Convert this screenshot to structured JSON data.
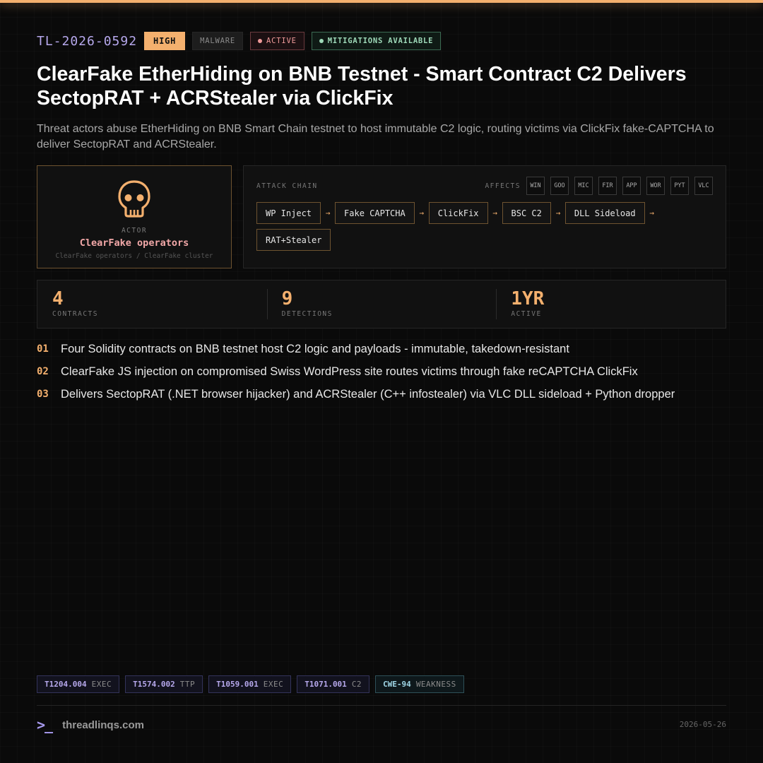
{
  "header": {
    "ticket_id": "TL-2026-0592",
    "severity": "HIGH",
    "category": "MALWARE",
    "status": "ACTIVE",
    "mitigation": "MITIGATIONS AVAILABLE"
  },
  "title": "ClearFake EtherHiding on BNB Testnet - Smart Contract C2 Delivers SectopRAT + ACRStealer via ClickFix",
  "subtitle": "Threat actors abuse EtherHiding on BNB Smart Chain testnet to host immutable C2 logic, routing victims via ClickFix fake-CAPTCHA to deliver SectopRAT and ACRStealer.",
  "actor": {
    "icon": "skull-icon",
    "label": "ACTOR",
    "name": "ClearFake operators",
    "aliases": "ClearFake operators / ClearFake cluster"
  },
  "chain": {
    "label": "ATTACK CHAIN",
    "affects_label": "AFFECTS",
    "affects": [
      "WIN",
      "GOO",
      "MIC",
      "FIR",
      "APP",
      "WOR",
      "PYT",
      "VLC"
    ],
    "arrow": "→",
    "steps": [
      "WP Inject",
      "Fake CAPTCHA",
      "ClickFix",
      "BSC C2",
      "DLL Sideload",
      "RAT+Stealer"
    ]
  },
  "stats": [
    {
      "value": "4",
      "label": "CONTRACTS"
    },
    {
      "value": "9",
      "label": "DETECTIONS"
    },
    {
      "value": "1YR",
      "label": "ACTIVE"
    }
  ],
  "points": [
    {
      "num": "01",
      "text": "Four Solidity contracts on BNB testnet host C2 logic and payloads - immutable, takedown-resistant"
    },
    {
      "num": "02",
      "text": "ClearFake JS injection on compromised Swiss WordPress site routes victims through fake reCAPTCHA ClickFix"
    },
    {
      "num": "03",
      "text": "Delivers SectopRAT (.NET browser hijacker) and ACRStealer (C++ infostealer) via VLC DLL sideload + Python dropper"
    }
  ],
  "techniques": [
    {
      "id": "T1204.004",
      "kind": "EXEC"
    },
    {
      "id": "T1574.002",
      "kind": "TTP"
    },
    {
      "id": "T1059.001",
      "kind": "EXEC"
    },
    {
      "id": "T1071.001",
      "kind": "C2"
    },
    {
      "id": "CWE-94",
      "kind": "WEAKNESS"
    }
  ],
  "footer": {
    "prompt": ">_",
    "brand": "threadlinqs.com",
    "date": "2026-05-26"
  },
  "colors": {
    "accent": "#f4b06e",
    "id_purple": "#b6a8ec",
    "active_red": "#f09a9a",
    "mitigation_green": "#9ed9b8"
  }
}
